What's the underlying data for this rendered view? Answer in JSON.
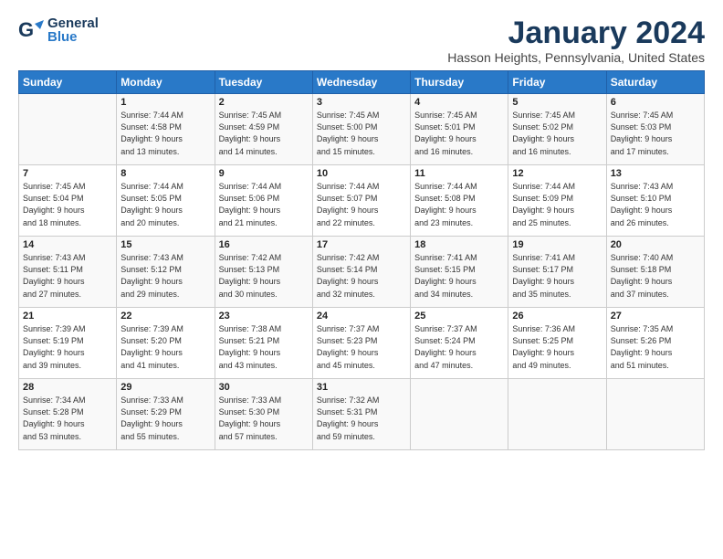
{
  "header": {
    "logo_general": "General",
    "logo_blue": "Blue",
    "month_title": "January 2024",
    "location": "Hasson Heights, Pennsylvania, United States"
  },
  "weekdays": [
    "Sunday",
    "Monday",
    "Tuesday",
    "Wednesday",
    "Thursday",
    "Friday",
    "Saturday"
  ],
  "weeks": [
    [
      {
        "day": "",
        "info": ""
      },
      {
        "day": "1",
        "info": "Sunrise: 7:44 AM\nSunset: 4:58 PM\nDaylight: 9 hours\nand 13 minutes."
      },
      {
        "day": "2",
        "info": "Sunrise: 7:45 AM\nSunset: 4:59 PM\nDaylight: 9 hours\nand 14 minutes."
      },
      {
        "day": "3",
        "info": "Sunrise: 7:45 AM\nSunset: 5:00 PM\nDaylight: 9 hours\nand 15 minutes."
      },
      {
        "day": "4",
        "info": "Sunrise: 7:45 AM\nSunset: 5:01 PM\nDaylight: 9 hours\nand 16 minutes."
      },
      {
        "day": "5",
        "info": "Sunrise: 7:45 AM\nSunset: 5:02 PM\nDaylight: 9 hours\nand 16 minutes."
      },
      {
        "day": "6",
        "info": "Sunrise: 7:45 AM\nSunset: 5:03 PM\nDaylight: 9 hours\nand 17 minutes."
      }
    ],
    [
      {
        "day": "7",
        "info": "Sunrise: 7:45 AM\nSunset: 5:04 PM\nDaylight: 9 hours\nand 18 minutes."
      },
      {
        "day": "8",
        "info": "Sunrise: 7:44 AM\nSunset: 5:05 PM\nDaylight: 9 hours\nand 20 minutes."
      },
      {
        "day": "9",
        "info": "Sunrise: 7:44 AM\nSunset: 5:06 PM\nDaylight: 9 hours\nand 21 minutes."
      },
      {
        "day": "10",
        "info": "Sunrise: 7:44 AM\nSunset: 5:07 PM\nDaylight: 9 hours\nand 22 minutes."
      },
      {
        "day": "11",
        "info": "Sunrise: 7:44 AM\nSunset: 5:08 PM\nDaylight: 9 hours\nand 23 minutes."
      },
      {
        "day": "12",
        "info": "Sunrise: 7:44 AM\nSunset: 5:09 PM\nDaylight: 9 hours\nand 25 minutes."
      },
      {
        "day": "13",
        "info": "Sunrise: 7:43 AM\nSunset: 5:10 PM\nDaylight: 9 hours\nand 26 minutes."
      }
    ],
    [
      {
        "day": "14",
        "info": "Sunrise: 7:43 AM\nSunset: 5:11 PM\nDaylight: 9 hours\nand 27 minutes."
      },
      {
        "day": "15",
        "info": "Sunrise: 7:43 AM\nSunset: 5:12 PM\nDaylight: 9 hours\nand 29 minutes."
      },
      {
        "day": "16",
        "info": "Sunrise: 7:42 AM\nSunset: 5:13 PM\nDaylight: 9 hours\nand 30 minutes."
      },
      {
        "day": "17",
        "info": "Sunrise: 7:42 AM\nSunset: 5:14 PM\nDaylight: 9 hours\nand 32 minutes."
      },
      {
        "day": "18",
        "info": "Sunrise: 7:41 AM\nSunset: 5:15 PM\nDaylight: 9 hours\nand 34 minutes."
      },
      {
        "day": "19",
        "info": "Sunrise: 7:41 AM\nSunset: 5:17 PM\nDaylight: 9 hours\nand 35 minutes."
      },
      {
        "day": "20",
        "info": "Sunrise: 7:40 AM\nSunset: 5:18 PM\nDaylight: 9 hours\nand 37 minutes."
      }
    ],
    [
      {
        "day": "21",
        "info": "Sunrise: 7:39 AM\nSunset: 5:19 PM\nDaylight: 9 hours\nand 39 minutes."
      },
      {
        "day": "22",
        "info": "Sunrise: 7:39 AM\nSunset: 5:20 PM\nDaylight: 9 hours\nand 41 minutes."
      },
      {
        "day": "23",
        "info": "Sunrise: 7:38 AM\nSunset: 5:21 PM\nDaylight: 9 hours\nand 43 minutes."
      },
      {
        "day": "24",
        "info": "Sunrise: 7:37 AM\nSunset: 5:23 PM\nDaylight: 9 hours\nand 45 minutes."
      },
      {
        "day": "25",
        "info": "Sunrise: 7:37 AM\nSunset: 5:24 PM\nDaylight: 9 hours\nand 47 minutes."
      },
      {
        "day": "26",
        "info": "Sunrise: 7:36 AM\nSunset: 5:25 PM\nDaylight: 9 hours\nand 49 minutes."
      },
      {
        "day": "27",
        "info": "Sunrise: 7:35 AM\nSunset: 5:26 PM\nDaylight: 9 hours\nand 51 minutes."
      }
    ],
    [
      {
        "day": "28",
        "info": "Sunrise: 7:34 AM\nSunset: 5:28 PM\nDaylight: 9 hours\nand 53 minutes."
      },
      {
        "day": "29",
        "info": "Sunrise: 7:33 AM\nSunset: 5:29 PM\nDaylight: 9 hours\nand 55 minutes."
      },
      {
        "day": "30",
        "info": "Sunrise: 7:33 AM\nSunset: 5:30 PM\nDaylight: 9 hours\nand 57 minutes."
      },
      {
        "day": "31",
        "info": "Sunrise: 7:32 AM\nSunset: 5:31 PM\nDaylight: 9 hours\nand 59 minutes."
      },
      {
        "day": "",
        "info": ""
      },
      {
        "day": "",
        "info": ""
      },
      {
        "day": "",
        "info": ""
      }
    ]
  ]
}
